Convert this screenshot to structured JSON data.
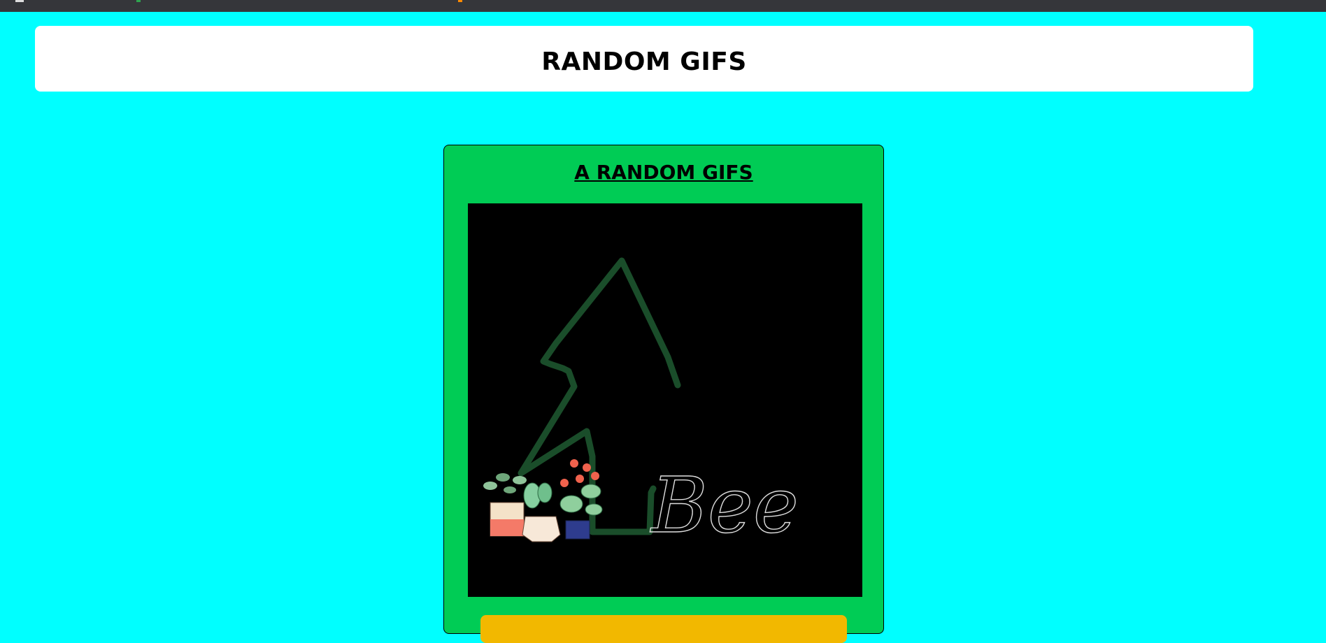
{
  "header": {
    "title": "RANDOM GIFS"
  },
  "card": {
    "title": "A RANDOM GIFS"
  },
  "gif": {
    "watermark_text": "Bee"
  },
  "colors": {
    "page_background": "#00ffff",
    "card_background": "#00cc55",
    "gif_background": "#000000",
    "button_background": "#f2b800",
    "header_background": "#ffffff"
  }
}
